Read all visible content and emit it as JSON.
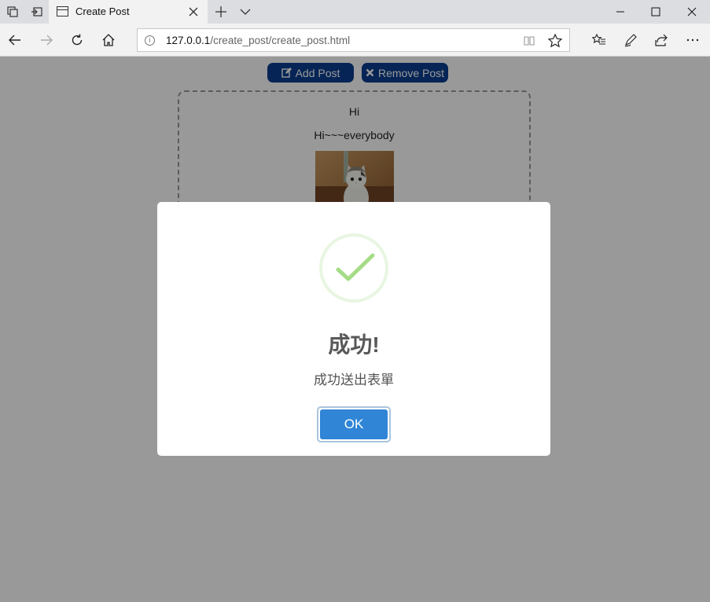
{
  "browser": {
    "tab_title": "Create Post",
    "url_host": "127.0.0.1",
    "url_path": "/create_post/create_post.html"
  },
  "page": {
    "add_post_label": "Add Post",
    "remove_post_label": "Remove Post",
    "post": {
      "title": "Hi",
      "body": "Hi~~~everybody"
    }
  },
  "dialog": {
    "title": "成功!",
    "text": "成功送出表單",
    "ok_label": "OK",
    "icon": "success-check-icon"
  },
  "colors": {
    "nav_button": "#0a3e8f",
    "ok_button": "#3085d6",
    "success_check": "#a5dc86"
  }
}
